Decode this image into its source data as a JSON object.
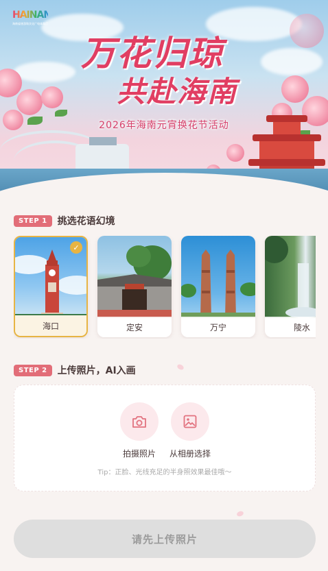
{
  "hero": {
    "logo_text": "HAINAN",
    "logo_sub": "海南省旅游和文化广电体育厅",
    "title_line1": "万花归琼",
    "title_line2": "共赴海南",
    "subtitle": "2026年海南元宵换花节活动"
  },
  "step1": {
    "badge": "STEP 1",
    "label": "挑选花语幻境"
  },
  "destinations": [
    {
      "name": "海口",
      "selected": true
    },
    {
      "name": "定安",
      "selected": false
    },
    {
      "name": "万宁",
      "selected": false
    },
    {
      "name": "陵水",
      "selected": false
    }
  ],
  "step2": {
    "badge": "STEP 2",
    "label": "上传照片，AI入画"
  },
  "upload": {
    "camera_label": "拍摄照片",
    "album_label": "从相册选择",
    "tip": "Tip：正脸、光线充足的半身照效果最佳哦～"
  },
  "submit_label": "请先上传照片",
  "colors": {
    "accent_pink": "#e26d78",
    "selected_gold": "#e7b443",
    "button_disabled": "#dedede"
  }
}
